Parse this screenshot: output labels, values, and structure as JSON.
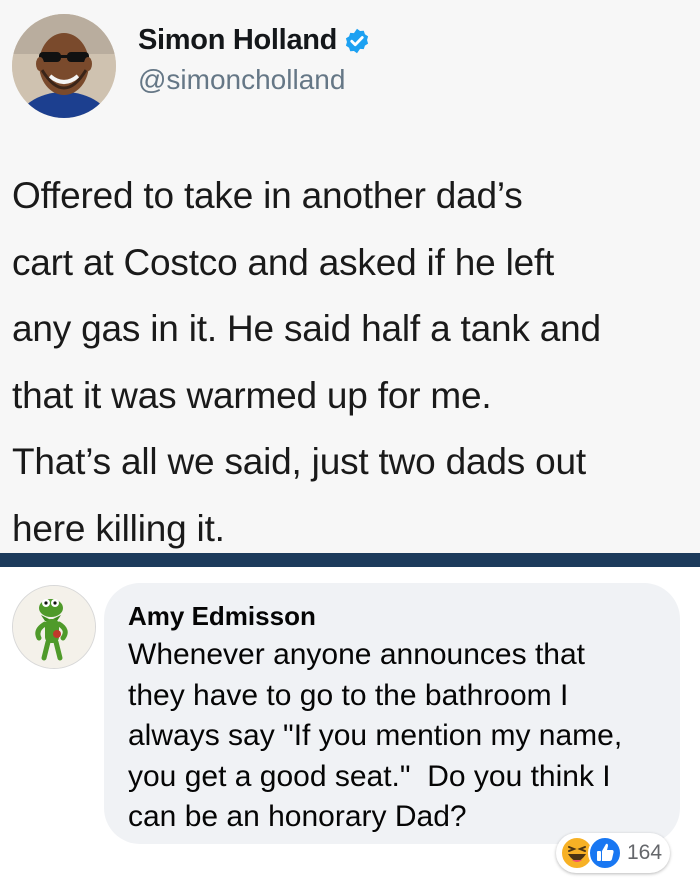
{
  "tweet": {
    "author_name": "Simon Holland",
    "handle": "@simoncholland",
    "text": "Offered to take in another dad’s\ncart at Costco and asked if he left\nany gas in it. He said half a tank and\nthat it was warmed up for me.\nThat’s all we said, just two dads out\nhere killing it.",
    "icons": {
      "verified": "verified-badge-icon"
    },
    "colors": {
      "verified": "#1da1f2",
      "handle": "#657786"
    }
  },
  "divider": {
    "color": "#1d3b5c"
  },
  "comment": {
    "author_name": "Amy Edmisson",
    "text": "Whenever anyone announces that\nthey have to go to the bathroom I\nalways say \"If you mention my name,\nyou get a good seat.\"  Do you think I\ncan be an honorary Dad?",
    "reactions": {
      "icons": [
        "haha-reaction-icon",
        "like-reaction-icon"
      ],
      "count": "164"
    },
    "colors": {
      "bubble": "#f0f2f5",
      "like": "#1877f2",
      "haha": "#f7b125"
    }
  }
}
